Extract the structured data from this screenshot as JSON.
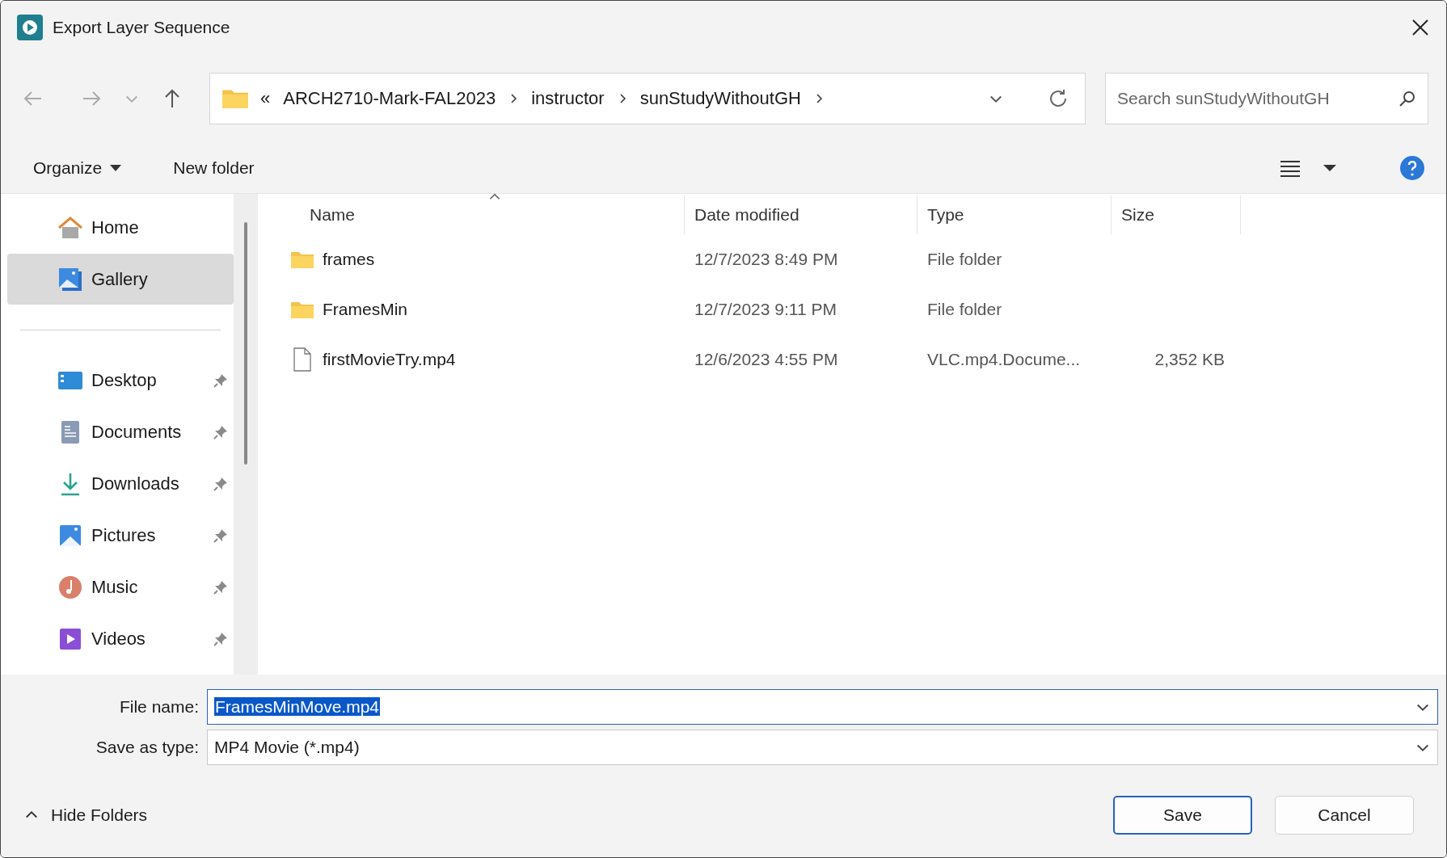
{
  "window": {
    "title": "Export Layer Sequence"
  },
  "address": {
    "overflow": "«",
    "crumbs": [
      "ARCH2710-Mark-FAL2023",
      "instructor",
      "sunStudyWithoutGH"
    ]
  },
  "search": {
    "placeholder": "Search sunStudyWithoutGH"
  },
  "toolbar": {
    "organize": "Organize",
    "new_folder": "New folder"
  },
  "sidebar": {
    "sections": [
      {
        "items": [
          {
            "kind": "home",
            "label": "Home",
            "selected": false,
            "pinned": false
          },
          {
            "kind": "gallery",
            "label": "Gallery",
            "selected": true,
            "pinned": false
          }
        ]
      },
      {
        "items": [
          {
            "kind": "desktop",
            "label": "Desktop",
            "selected": false,
            "pinned": true
          },
          {
            "kind": "documents",
            "label": "Documents",
            "selected": false,
            "pinned": true
          },
          {
            "kind": "downloads",
            "label": "Downloads",
            "selected": false,
            "pinned": true
          },
          {
            "kind": "pictures",
            "label": "Pictures",
            "selected": false,
            "pinned": true
          },
          {
            "kind": "music",
            "label": "Music",
            "selected": false,
            "pinned": true
          },
          {
            "kind": "videos",
            "label": "Videos",
            "selected": false,
            "pinned": true
          }
        ]
      }
    ]
  },
  "table": {
    "columns": [
      {
        "label": "Name",
        "sorted": true
      },
      {
        "label": "Date modified",
        "sorted": false
      },
      {
        "label": "Type",
        "sorted": false
      },
      {
        "label": "Size",
        "sorted": false
      }
    ],
    "rows": [
      {
        "kind": "folder",
        "name": "frames",
        "date": "12/7/2023 8:49 PM",
        "type": "File folder",
        "size": ""
      },
      {
        "kind": "folder",
        "name": "FramesMin",
        "date": "12/7/2023 9:11 PM",
        "type": "File folder",
        "size": ""
      },
      {
        "kind": "file",
        "name": "firstMovieTry.mp4",
        "date": "12/6/2023 4:55 PM",
        "type": "VLC.mp4.Docume...",
        "size": "2,352 KB"
      }
    ]
  },
  "form": {
    "file_name": {
      "label": "File name:",
      "value": "FramesMinMove.mp4",
      "selected": true
    },
    "save_as_type": {
      "label": "Save as type:",
      "value": "MP4 Movie (*.mp4)"
    }
  },
  "footer": {
    "hide_folders": "Hide Folders",
    "buttons": [
      {
        "label": "Save",
        "selected": true
      },
      {
        "label": "Cancel",
        "selected": false
      }
    ]
  }
}
